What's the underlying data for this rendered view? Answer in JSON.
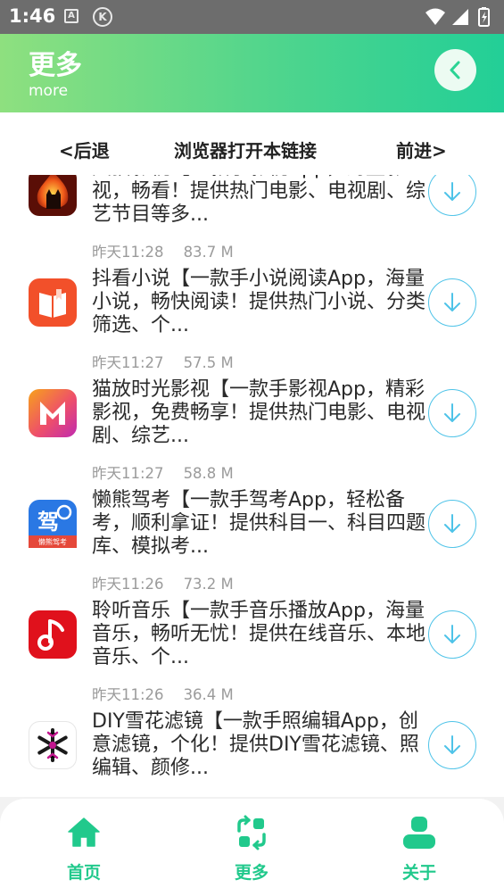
{
  "status_bar": {
    "time": "1:46",
    "icon_a": "A",
    "icon_k": "K"
  },
  "header": {
    "title": "更多",
    "subtitle": "more"
  },
  "browser_nav": {
    "back": "<后退",
    "open_in_browser": "浏览器打开本链接",
    "forward": "前进>"
  },
  "apps": [
    {
      "description": "天猫影视【一款手影视App，海量影视，畅看！提供热门电影、电视剧、综艺节目等多...",
      "time": "昨天11:28",
      "size": "83.7 M",
      "icon": "cat-fire-icon"
    },
    {
      "description": "抖看小说【一款手小说阅读App，海量小说，畅快阅读！提供热门小说、分类筛选、个...",
      "time": "昨天11:27",
      "size": "57.5 M",
      "icon": "book-icon"
    },
    {
      "description": "猫放时光影视【一款手影视App，精彩影视，免费畅享！提供热门电影、电视剧、综艺...",
      "time": "昨天11:27",
      "size": "58.8 M",
      "icon": "letter-m-icon"
    },
    {
      "description": "懒熊驾考【一款手驾考App，轻松备考，顺利拿证！提供科目一、科目四题库、模拟考...",
      "time": "昨天11:26",
      "size": "73.2 M",
      "icon": "drive-exam-icon",
      "icon_text": "驾",
      "icon_badge": "懒熊驾考"
    },
    {
      "description": "聆听音乐【一款手音乐播放App，海量音乐，畅听无忧！提供在线音乐、本地音乐、个...",
      "time": "昨天11:26",
      "size": "36.4 M",
      "icon": "music-note-icon"
    },
    {
      "description": "DIY雪花滤镜【一款手照编辑App，创意滤镜，个化！提供DIY雪花滤镜、照编辑、颜修...",
      "time": "",
      "size": "",
      "icon": "snowflake-icon"
    }
  ],
  "bottom_nav": {
    "home": "首页",
    "more": "更多",
    "about": "关于"
  },
  "colors": {
    "accent": "#21c98c",
    "download": "#4ec3e8"
  }
}
